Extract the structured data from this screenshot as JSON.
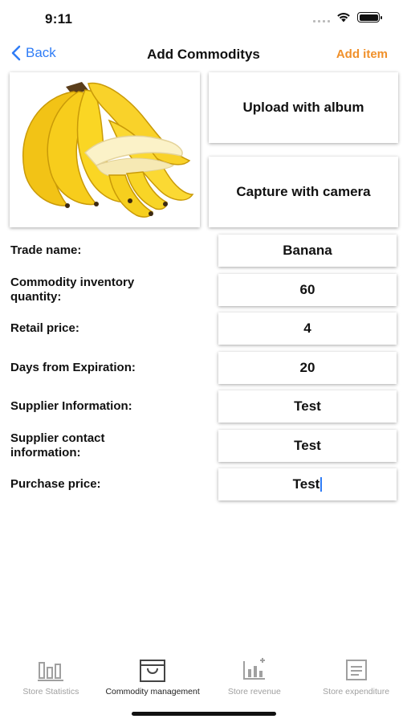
{
  "status_bar": {
    "time": "9:11"
  },
  "nav": {
    "back_label": "Back",
    "title": "Add Commoditys",
    "add_item_label": "Add item"
  },
  "media": {
    "photo_description": "bananas",
    "upload_label": "Upload with album",
    "camera_label": "Capture with camera"
  },
  "form": {
    "fields": [
      {
        "label": "Trade name:",
        "value": "Banana"
      },
      {
        "label": "Commodity inventory quantity:",
        "value": "60"
      },
      {
        "label": "Retail price:",
        "value": "4"
      },
      {
        "label": "Days from Expiration:",
        "value": "20"
      },
      {
        "label": "Supplier Information:",
        "value": "Test"
      },
      {
        "label": "Supplier contact information:",
        "value": "Test"
      },
      {
        "label": "Purchase price:",
        "value": "Test"
      }
    ]
  },
  "tabs": [
    {
      "label": "Store Statistics",
      "icon": "bar-chart-icon",
      "active": false
    },
    {
      "label": "Commodity management",
      "icon": "shopping-bag-icon",
      "active": true
    },
    {
      "label": "Store revenue",
      "icon": "revenue-chart-icon",
      "active": false
    },
    {
      "label": "Store expenditure",
      "icon": "expenditure-icon",
      "active": false
    }
  ],
  "colors": {
    "accent_blue": "#2f7cf6",
    "accent_orange": "#f0902a",
    "inactive_gray": "#a0a0a0"
  }
}
